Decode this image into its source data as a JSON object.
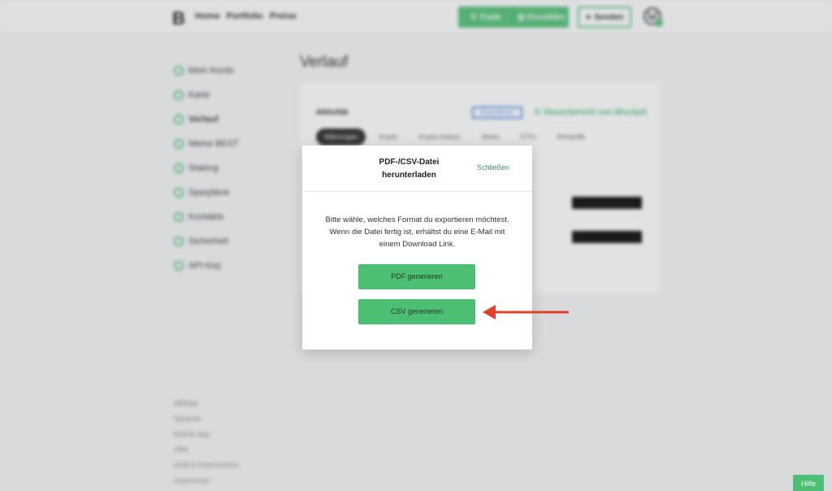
{
  "header": {
    "logo": "B",
    "nav": [
      "Home",
      "Portfolio",
      "Preise"
    ],
    "trade_label": "Trade",
    "deposit_label": "Einzahlen",
    "send_label": "Senden"
  },
  "sidebar": {
    "items": [
      {
        "label": "Mein Konto",
        "icon": "account-icon"
      },
      {
        "label": "Karte",
        "icon": "card-icon"
      },
      {
        "label": "Verlauf",
        "icon": "history-icon",
        "active": true
      },
      {
        "label": "Meine BEST",
        "icon": "best-icon"
      },
      {
        "label": "Staking",
        "icon": "staking-icon"
      },
      {
        "label": "Sparpläne",
        "icon": "savings-icon"
      },
      {
        "label": "Kontakte",
        "icon": "contacts-icon"
      },
      {
        "label": "Sicherheit",
        "icon": "security-icon"
      },
      {
        "label": "API-Key",
        "icon": "api-key-icon"
      }
    ],
    "footer": [
      "Affiliate",
      "Sprache",
      "Mobile App",
      "Hilfe",
      "AGB & Datenschutz",
      "Impressum"
    ]
  },
  "main": {
    "page_title": "Verlauf",
    "activity_label": "Aktivität",
    "export_label": "Exportieren",
    "blockpit_label": "Steuerbericht von Blockpit",
    "tabs": [
      "Währungen",
      "Krypto",
      "Krypto-Indizes",
      "Aktien",
      "ETFs",
      "Rohstoffe"
    ]
  },
  "modal": {
    "title": "PDF-/CSV-Datei herunterladen",
    "close_label": "Schließen",
    "body": "Bitte wähle, welches Format du exportieren möchtest. Wenn die Datei fertig ist, erhältst du eine E-Mail mit einem Download Link.",
    "pdf_button": "PDF generieren",
    "csv_button": "CSV generieren"
  },
  "help_label": "Hilfe",
  "colors": {
    "accent": "#4cbf73",
    "arrow": "#e0412d"
  }
}
